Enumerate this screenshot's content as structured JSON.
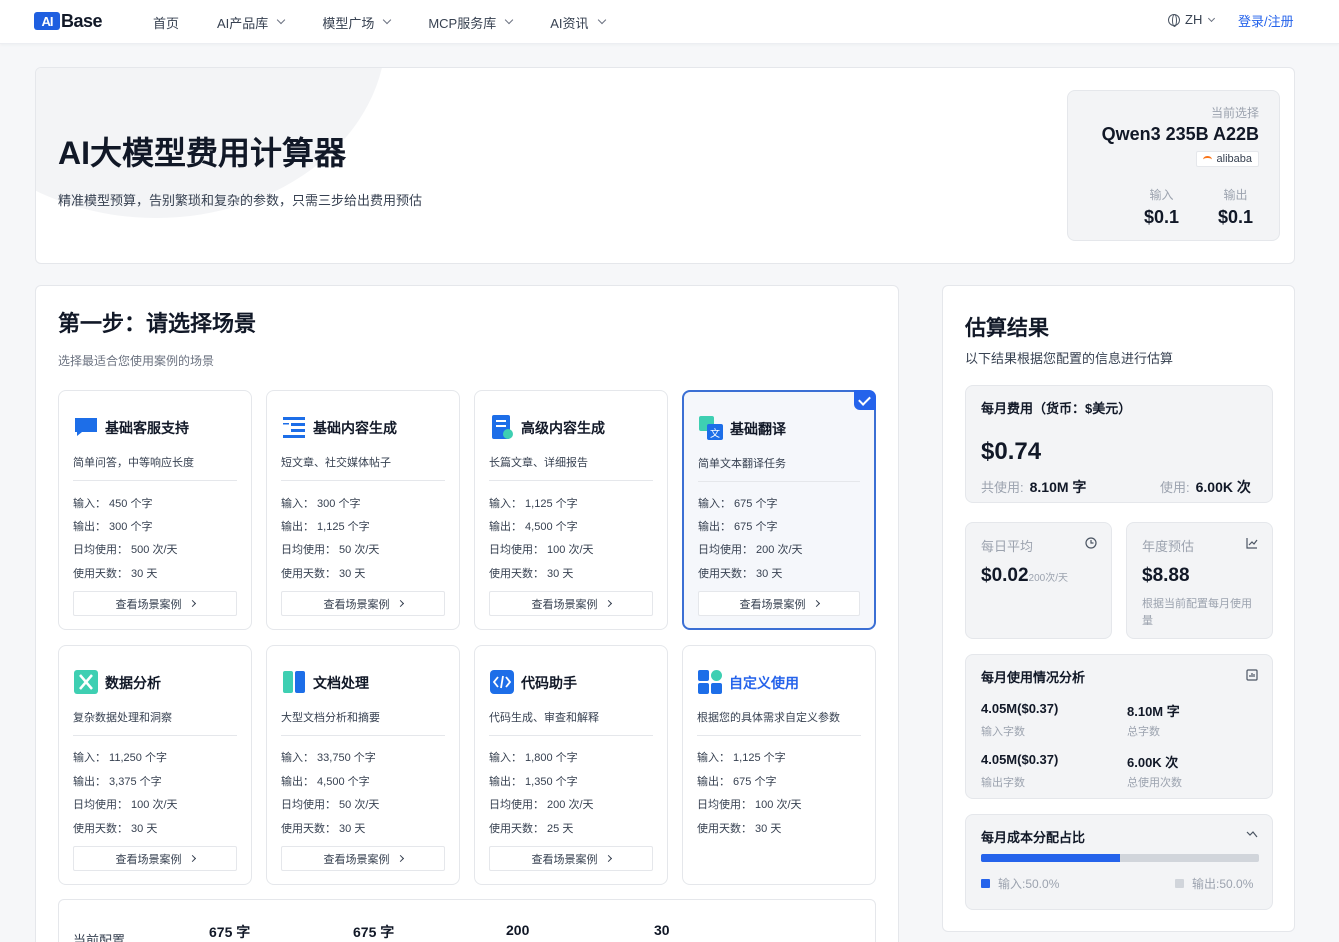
{
  "nav": {
    "logo_mark": "AI",
    "logo_text": "Base",
    "items": [
      "首页",
      "AI产品库",
      "模型广场",
      "MCP服务库",
      "AI资讯"
    ],
    "lang": "ZH",
    "login": "登录/注册"
  },
  "hero": {
    "title": "AI大模型费用计算器",
    "subtitle": "精准模型预算，告别繁琐和复杂的参数，只需三步给出费用预估"
  },
  "selection": {
    "label": "当前选择",
    "model": "Qwen3 235B A22B",
    "vendor": "alibaba",
    "input_label": "输入",
    "input_price": "$0.1",
    "output_label": "输出",
    "output_price": "$0.1"
  },
  "step1": {
    "title": "第一步：请选择场景",
    "subtitle": "选择最适合您使用案例的场景",
    "button_label": "查看场景案例",
    "scenarios": [
      {
        "name": "基础客服支持",
        "desc": "简单问答，中等响应长度",
        "input": "输入： 450 个字",
        "output": "输出： 300 个字",
        "daily": "日均使用： 500 次/天",
        "days": "使用天数： 30 天",
        "icon": "chat-icon",
        "selected": false
      },
      {
        "name": "基础内容生成",
        "desc": "短文章、社交媒体帖子",
        "input": "输入： 300 个字",
        "output": "输出： 1,125 个字",
        "daily": "日均使用： 50 次/天",
        "days": "使用天数： 30 天",
        "icon": "text-lines-icon",
        "selected": false
      },
      {
        "name": "高级内容生成",
        "desc": "长篇文章、详细报告",
        "input": "输入： 1,125 个字",
        "output": "输出： 4,500 个字",
        "daily": "日均使用： 100 次/天",
        "days": "使用天数： 30 天",
        "icon": "document-star-icon",
        "selected": false
      },
      {
        "name": "基础翻译",
        "desc": "简单文本翻译任务",
        "input": "输入： 675 个字",
        "output": "输出： 675 个字",
        "daily": "日均使用： 200 次/天",
        "days": "使用天数： 30 天",
        "icon": "translate-icon",
        "selected": true
      },
      {
        "name": "数据分析",
        "desc": "复杂数据处理和洞察",
        "input": "输入： 11,250 个字",
        "output": "输出： 3,375 个字",
        "daily": "日均使用： 100 次/天",
        "days": "使用天数： 30 天",
        "icon": "excel-icon",
        "selected": false
      },
      {
        "name": "文档处理",
        "desc": "大型文档分析和摘要",
        "input": "输入： 33,750 个字",
        "output": "输出： 4,500 个字",
        "daily": "日均使用： 50 次/天",
        "days": "使用天数： 30 天",
        "icon": "book-icon",
        "selected": false
      },
      {
        "name": "代码助手",
        "desc": "代码生成、审查和解释",
        "input": "输入： 1,800 个字",
        "output": "输出： 1,350 个字",
        "daily": "日均使用： 200 次/天",
        "days": "使用天数： 25 天",
        "icon": "code-icon",
        "selected": false
      },
      {
        "name": "自定义使用",
        "desc": "根据您的具体需求自定义参数",
        "input": "输入： 1,125 个字",
        "output": "输出： 675 个字",
        "daily": "日均使用： 100 次/天",
        "days": "使用天数： 30 天",
        "icon": "grid-icon",
        "selected": false
      }
    ],
    "current_config": {
      "label": "当前配置",
      "values": [
        "675 字",
        "675 字",
        "200",
        "30"
      ]
    }
  },
  "results": {
    "title": "估算结果",
    "subtitle": "以下结果根据您配置的信息进行估算",
    "monthly": {
      "head": "每月费用（货币：$美元）",
      "cost": "$0.74",
      "total_label": "共使用:",
      "total_value": "8.10M 字",
      "uses_label": "使用:",
      "uses_value": "6.00K 次"
    },
    "daily": {
      "label": "每日平均",
      "value": "$0.02",
      "unit": "200次/天"
    },
    "yearly": {
      "label": "年度预估",
      "value": "$8.88",
      "note": "根据当前配置每月使用量"
    },
    "analysis": {
      "head": "每月使用情况分析",
      "items": [
        {
          "value": "4.05M($0.37)",
          "label": "输入字数"
        },
        {
          "value": "8.10M 字",
          "label": "总字数"
        },
        {
          "value": "4.05M($0.37)",
          "label": "输出字数"
        },
        {
          "value": "6.00K 次",
          "label": "总使用次数"
        }
      ]
    },
    "distribution": {
      "head": "每月成本分配占比",
      "input_share": 0.5,
      "input_label": "输入:50.0%",
      "output_label": "输出:50.0%",
      "input_color": "#2563eb",
      "output_color": "#d1d5db"
    }
  }
}
